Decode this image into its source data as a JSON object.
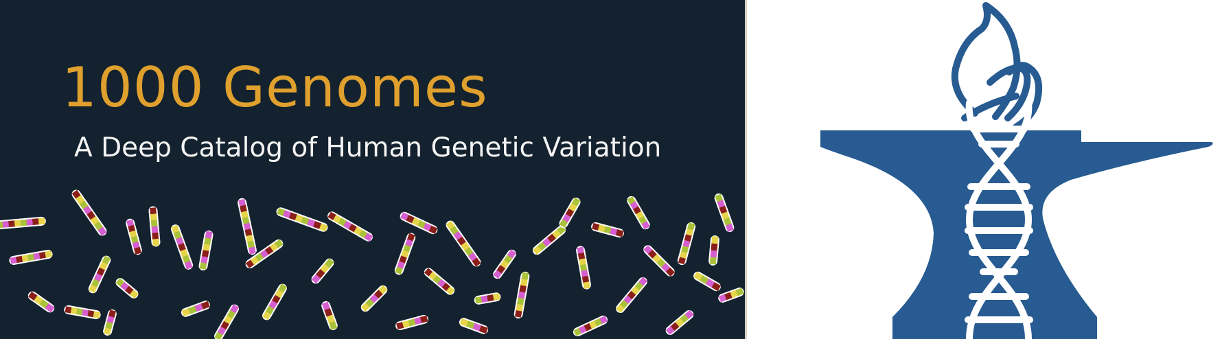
{
  "banner": {
    "title": "1000 Genomes",
    "subtitle": "A Deep Catalog of Human Genetic Variation",
    "icon": "chromosome-icon"
  },
  "logo": {
    "icon": "dna-anvil-flame-logo-icon"
  },
  "colors": {
    "banner_background": "#13222e",
    "title": "#e0a02e",
    "subtitle": "#f4f4f4",
    "logo_blue": "#275b91",
    "chromosome_green": "#a9c23a",
    "chromosome_yellow": "#e6d44a",
    "chromosome_red": "#8a1f1a",
    "chromosome_magenta": "#d65fd0"
  }
}
